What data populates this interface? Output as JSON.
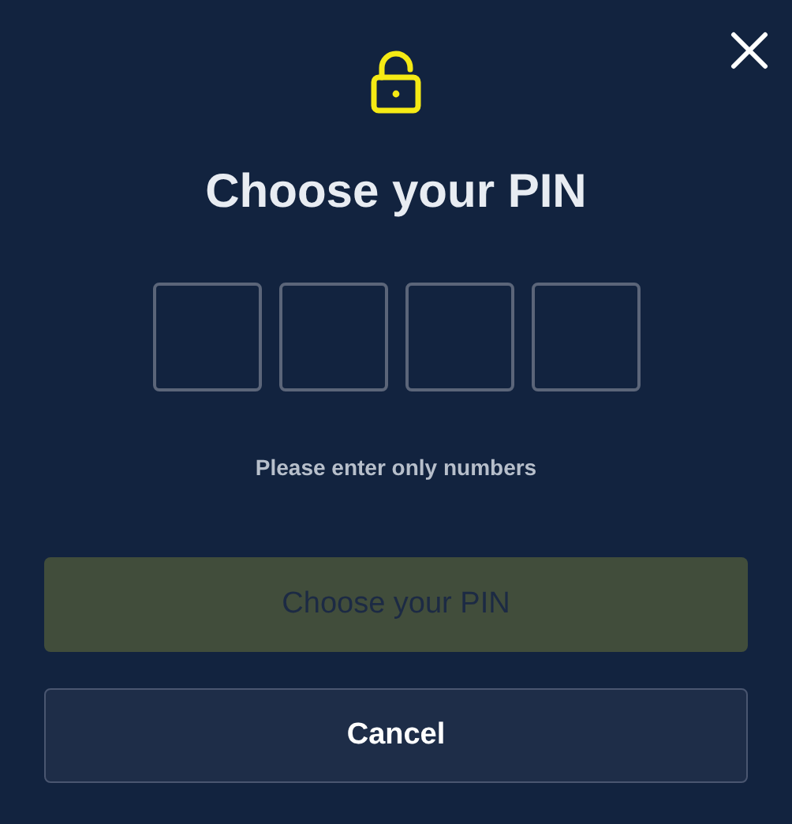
{
  "dialog": {
    "title": "Choose your PIN",
    "closable": true,
    "locked": false
  },
  "pin_boxes": [
    {
      "kind": "digit"
    },
    {
      "kind": "digit"
    },
    {
      "kind": "digit"
    },
    {
      "kind": "digit"
    }
  ],
  "hint": "Please enter only numbers",
  "buttons": [
    {
      "label": "Choose your PIN",
      "kind": "primary",
      "disabled": true
    },
    {
      "label": "Cancel",
      "kind": "secondary",
      "disabled": false
    }
  ]
}
